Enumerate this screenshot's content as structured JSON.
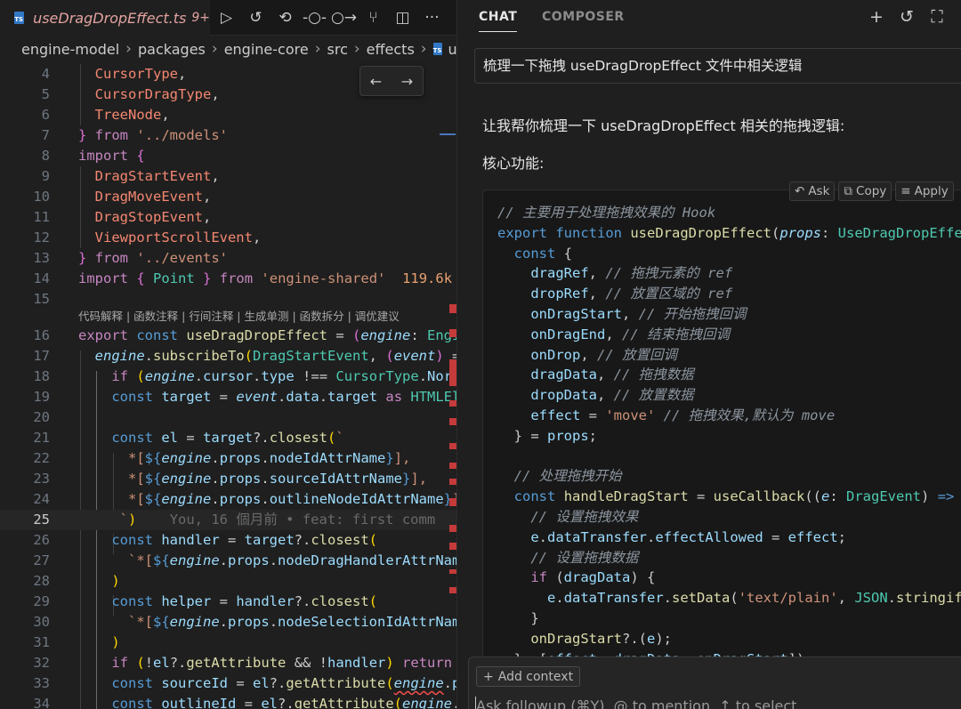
{
  "editor": {
    "tab": {
      "badge": "TS",
      "filename": "useDragDropEffect.ts",
      "problems": "9+"
    },
    "tab_actions": [
      "run-icon",
      "history-icon",
      "go-back-icon",
      "commit-icon",
      "go-forward-icon",
      "git-graph-icon",
      "split-editor-icon",
      "more-icon"
    ],
    "breadcrumb": [
      "engine-model",
      "packages",
      "engine-core",
      "src",
      "effects",
      "u"
    ],
    "find_widget": {
      "prev": "←",
      "next": "→"
    },
    "codelens": "代码解释 | 函数注释 | 行间注释 | 生成单测 | 函数拆分 | 调优建议",
    "import_size": "119.6k",
    "blame": "You, 16 個月前 • feat: first comm",
    "line_numbers": [
      "4",
      "5",
      "6",
      "7",
      "8",
      "9",
      "10",
      "11",
      "12",
      "13",
      "14",
      "15",
      "16",
      "17",
      "18",
      "19",
      "20",
      "21",
      "22",
      "23",
      "24",
      "25",
      "26",
      "27",
      "28",
      "29",
      "30",
      "31",
      "32",
      "33",
      "34"
    ],
    "active_line": "25"
  },
  "chat": {
    "tabs": {
      "active": "CHAT",
      "inactive": "COMPOSER"
    },
    "header_icons": [
      "plus-icon",
      "history-icon",
      "maximize-icon"
    ],
    "query": "梳理一下拖拽 useDragDropEffect 文件中相关逻辑",
    "reply_intro": "让我帮你梳理一下 useDragDropEffect 相关的拖拽逻辑:",
    "core_heading": "核心功能:",
    "code_actions": {
      "ask": "Ask",
      "copy": "Copy",
      "apply": "Apply"
    },
    "add_context": "Add context",
    "followup_placeholder": "Ask followup (⌘Y), @ to mention, ↑ to select"
  },
  "colors": {
    "editor_bg": "#1f1f1f",
    "keyword": "#569cd6",
    "control": "#c586c0",
    "function": "#dcdcaa",
    "string": "#ce9178",
    "type": "#4ec9b0",
    "variable": "#9cdcfe",
    "comment": "#8b949e",
    "problem_marker": "#c53a3a"
  }
}
